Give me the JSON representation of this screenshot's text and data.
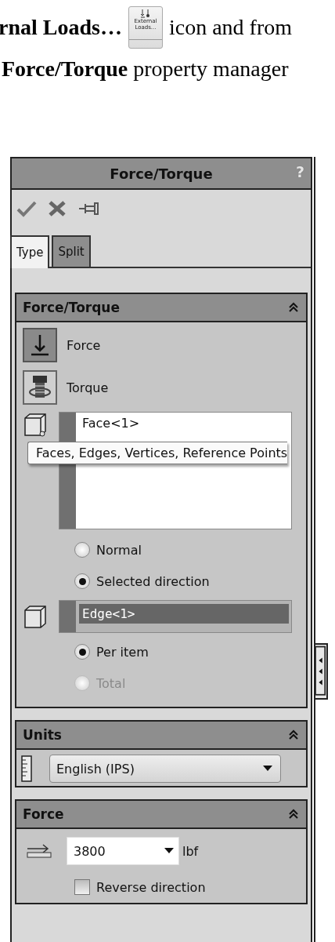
{
  "caption": {
    "line1_bold": "rnal Loads…",
    "icon_button": {
      "label": "External Loads..."
    },
    "line1_rest": "icon and from",
    "line2": "**Force/Torque** property manager"
  },
  "panel": {
    "title": "Force/Torque",
    "help": "?",
    "tabs": [
      {
        "label": "Type",
        "selected": true
      },
      {
        "label": "Split",
        "selected": false
      }
    ],
    "force_torque": {
      "title": "Force/Torque",
      "types": [
        {
          "kind": "force",
          "label": "Force",
          "selected": true
        },
        {
          "kind": "torque",
          "label": "Torque",
          "selected": false
        }
      ],
      "selection_list": {
        "items": [
          "Face<1>"
        ]
      },
      "tooltip": "Faces, Edges, Vertices, Reference Points",
      "direction_options": [
        {
          "label": "Normal",
          "selected": false,
          "disabled": false
        },
        {
          "label": "Selected direction",
          "selected": true,
          "disabled": false
        }
      ],
      "direction_field": {
        "value": "Edge<1>"
      },
      "distribution_options": [
        {
          "label": "Per item",
          "selected": true,
          "disabled": false
        },
        {
          "label": "Total",
          "selected": false,
          "disabled": true
        }
      ]
    },
    "units": {
      "title": "Units",
      "value": "English (IPS)"
    },
    "force": {
      "title": "Force",
      "value": "3800",
      "unit": "lbf",
      "reverse": {
        "label": "Reverse direction",
        "checked": false
      }
    }
  }
}
